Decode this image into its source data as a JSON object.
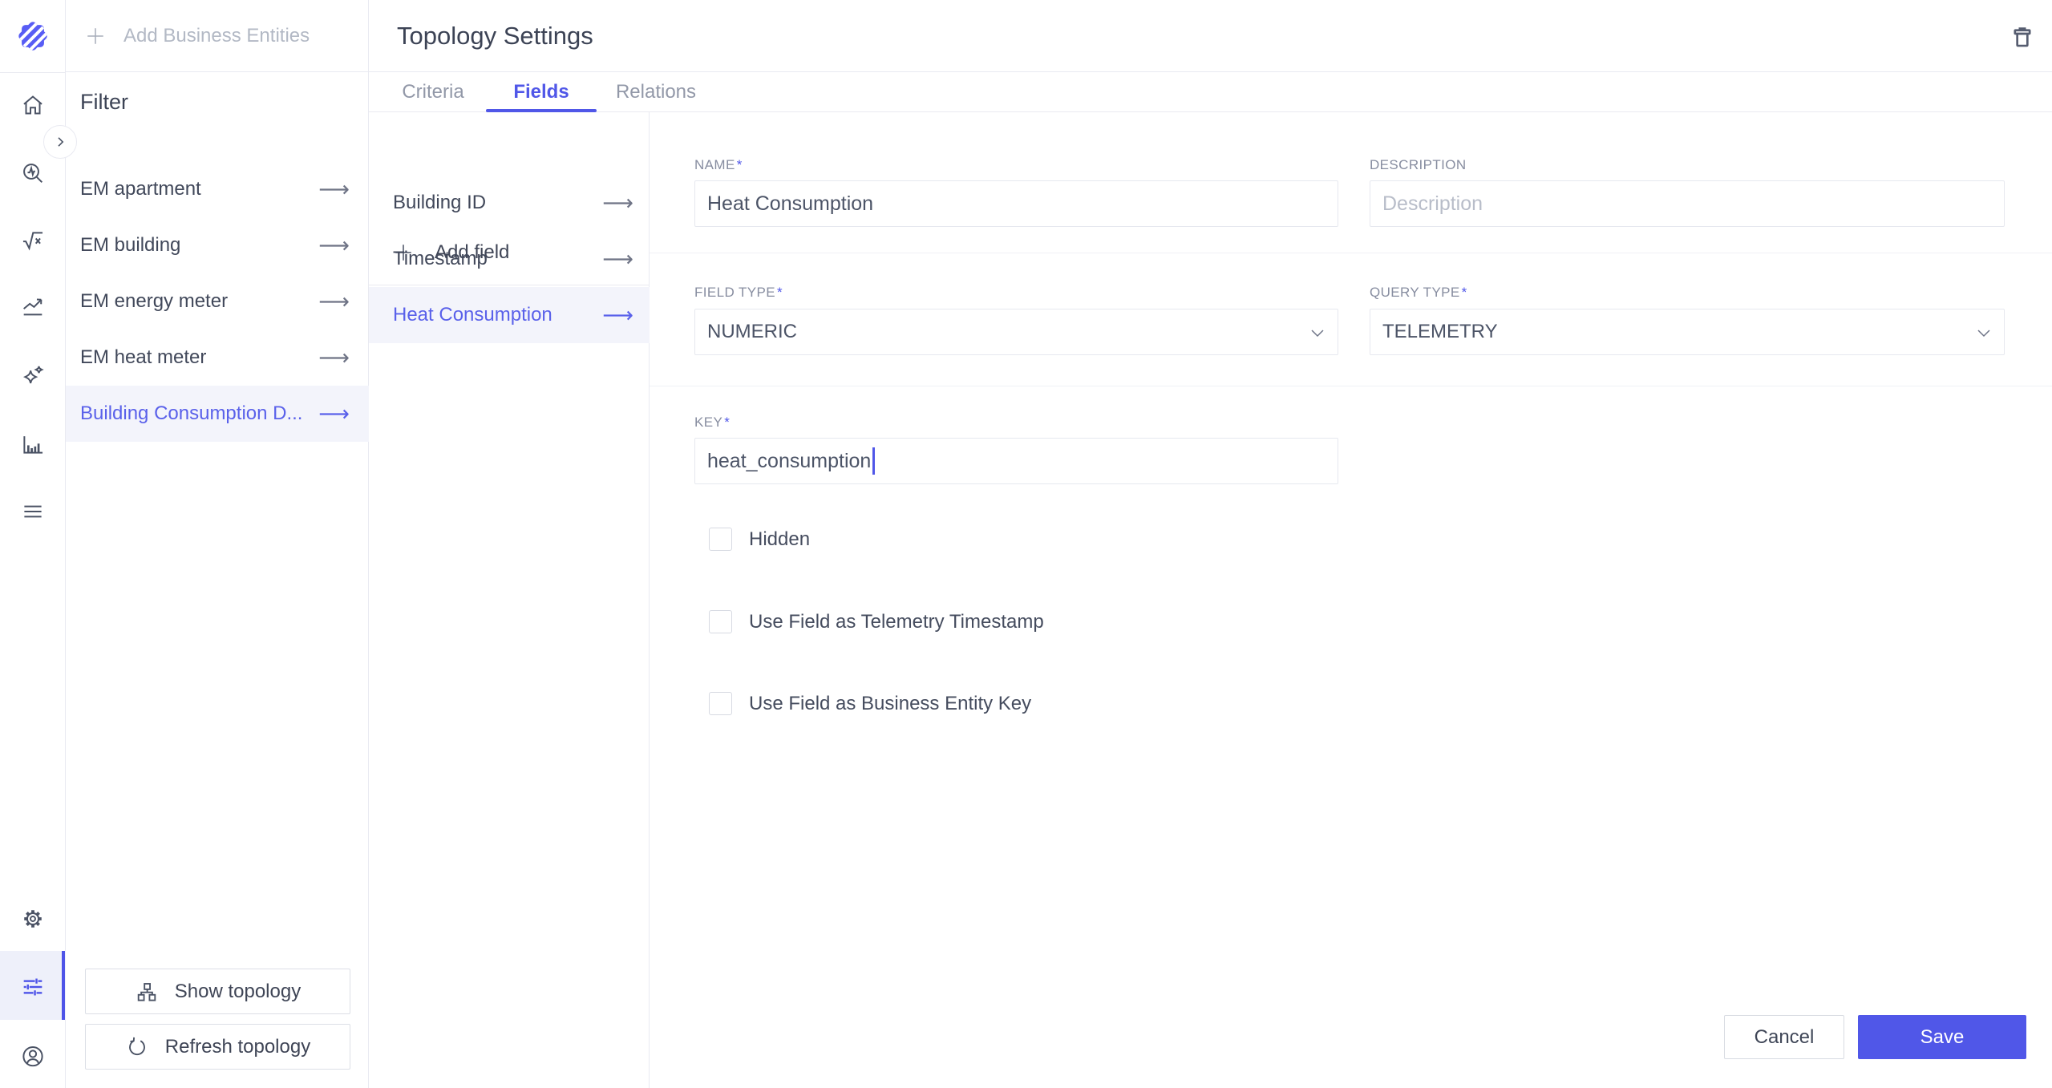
{
  "colors": {
    "accent": "#5057e8",
    "selected_row_bg": "#f3f4fb",
    "sidebar_active_bg": "#eef0fa",
    "icon_color": "#4a5264",
    "border_color": "#e9eaf1"
  },
  "icons": {
    "arrow_right": "⟶"
  },
  "filter_panel": {
    "add_business_entities_label": "Add Business Entities",
    "title": "Filter",
    "items": [
      {
        "label": "EM apartment",
        "selected": false
      },
      {
        "label": "EM building",
        "selected": false
      },
      {
        "label": "EM energy meter",
        "selected": false
      },
      {
        "label": "EM heat meter",
        "selected": false
      },
      {
        "label": "Building Consumption D...",
        "selected": true
      }
    ],
    "show_topology_label": "Show topology",
    "refresh_topology_label": "Refresh topology"
  },
  "header": {
    "title": "Topology Settings"
  },
  "tabs": [
    {
      "label": "Criteria",
      "active": false
    },
    {
      "label": "Fields",
      "active": true
    },
    {
      "label": "Relations",
      "active": false
    }
  ],
  "fields_panel": {
    "add_field_label": "Add field",
    "items": [
      {
        "label": "Building ID",
        "selected": false
      },
      {
        "label": "Timestamp",
        "selected": false
      },
      {
        "label": "Heat Consumption",
        "selected": true
      }
    ]
  },
  "form": {
    "required_mark": "*",
    "name": {
      "label": "NAME",
      "value": "Heat Consumption"
    },
    "description": {
      "label": "DESCRIPTION",
      "placeholder": "Description"
    },
    "field_type": {
      "label": "FIELD TYPE",
      "value": "NUMERIC"
    },
    "query_type": {
      "label": "QUERY TYPE",
      "value": "TELEMETRY"
    },
    "key": {
      "label": "KEY",
      "value": "heat_consumption"
    },
    "checkboxes": [
      {
        "label": "Hidden",
        "checked": false
      },
      {
        "label": "Use Field as Telemetry Timestamp",
        "checked": false
      },
      {
        "label": "Use Field as Business Entity Key",
        "checked": false
      }
    ],
    "cancel_label": "Cancel",
    "save_label": "Save"
  }
}
